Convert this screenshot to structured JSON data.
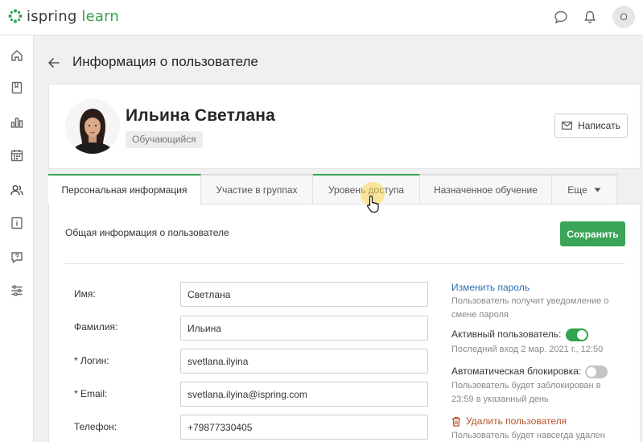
{
  "app": {
    "logo_text_a": "ispring",
    "logo_text_b": " learn",
    "user_initial": "O"
  },
  "icons": {
    "top": [
      "chat-icon",
      "bell-icon"
    ],
    "sidebar": [
      "home-icon",
      "book-icon",
      "bar-chart-icon",
      "calendar-icon",
      "users-icon",
      "info-card-icon",
      "help-chat-icon",
      "settings-sliders-icon"
    ]
  },
  "page": {
    "title": "Информация о пользователе"
  },
  "profile": {
    "name": "Ильина Светлана",
    "role": "Обучающийся",
    "write_label": "Написать"
  },
  "tabs": [
    {
      "label": "Персональная информация",
      "active": true
    },
    {
      "label": "Участие в группах",
      "active": false
    },
    {
      "label": "Уровень доступа",
      "active": false
    },
    {
      "label": "Назначенное обучение",
      "active": false
    },
    {
      "label": "Еще",
      "active": false
    }
  ],
  "form": {
    "section_title": "Общая информация о пользователе",
    "save_label": "Сохранить",
    "fields": [
      {
        "label": "Имя:",
        "value": "Светлана"
      },
      {
        "label": "Фамилия:",
        "value": "Ильина"
      },
      {
        "label": "* Логин:",
        "value": "svetlana.ilyina"
      },
      {
        "label": "* Email:",
        "value": "svetlana.ilyina@ispring.com"
      },
      {
        "label": "Телефон:",
        "value": "+79877330405"
      }
    ]
  },
  "side_panel": {
    "change_password": "Изменить пароль",
    "change_password_note": "Пользователь получит уведомление о смене пароля",
    "active_user_label": "Активный пользователь:",
    "active_user_on": true,
    "last_login": "Последний вход 2 мар. 2021 г., 12:50",
    "auto_block_label": "Автоматическая блокировка:",
    "auto_block_on": false,
    "auto_block_note": "Пользователь будет заблокирован в 23:59 в указанный день",
    "delete_label": "Удалить пользователя",
    "delete_note": "Пользователь будет навсегда удален из"
  },
  "colors": {
    "accent": "#33a34f",
    "link": "#2d6fb2",
    "danger": "#b5532d",
    "toggle_off": "#c4c4c4"
  }
}
